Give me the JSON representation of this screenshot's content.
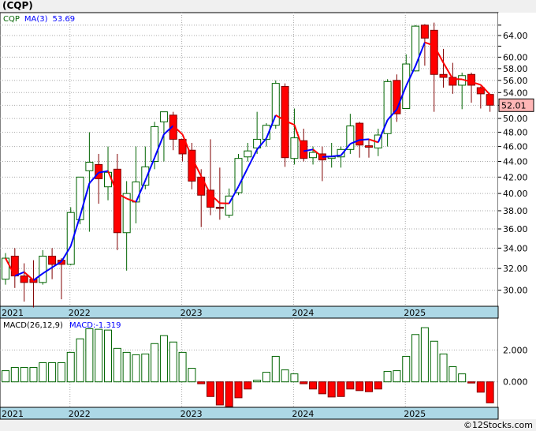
{
  "header": {
    "title": "(CQP)"
  },
  "footer": {
    "copyright": "©12Stocks.com"
  },
  "colors": {
    "up": "#006400",
    "down": "#ff0000",
    "ma_up": "#0000ff",
    "ma_down": "#ff0000",
    "axis_strip": "#add8e6",
    "last_price_bg": "#ffb6b6"
  },
  "chart_data": [
    {
      "type": "candlestick",
      "legend": {
        "symbol": "CQP",
        "ma_label": "MA(3)",
        "ma_value": "53.69"
      },
      "last_price": "52.01",
      "y_scale": "log",
      "ylim": [
        28.6,
        68.5
      ],
      "y_ticks": [
        "30.00",
        "32.00",
        "34.00",
        "36.00",
        "38.00",
        "40.00",
        "42.00",
        "44.00",
        "46.00",
        "48.00",
        "50.00",
        "52.00",
        "54.00",
        "56.00",
        "58.00",
        "60.00",
        "64.00"
      ],
      "x_labels": [
        "2021",
        "2022",
        "2023",
        "2024",
        "2025"
      ],
      "grid": true,
      "frequency": "monthly",
      "ohlc": [
        [
          31,
          33.5,
          30.5,
          33
        ],
        [
          33.2,
          34,
          30.2,
          31.3
        ],
        [
          31.3,
          32.5,
          29,
          30.7
        ],
        [
          31,
          32.8,
          28.5,
          30.7
        ],
        [
          30.7,
          33.8,
          30.5,
          33.2
        ],
        [
          33.2,
          34,
          31,
          32.4
        ],
        [
          32.8,
          33,
          29.2,
          32.4
        ],
        [
          32.4,
          38.4,
          32.3,
          37.8
        ],
        [
          37,
          42,
          36.5,
          42
        ],
        [
          42.8,
          48,
          35.7,
          43.9
        ],
        [
          43.6,
          45,
          38.8,
          41.8
        ],
        [
          40.8,
          46,
          39.2,
          42.6
        ],
        [
          43,
          45,
          33.8,
          35.6
        ],
        [
          35.6,
          41.5,
          31.8,
          40
        ],
        [
          39,
          46,
          36.6,
          41.4
        ],
        [
          41,
          46,
          40.5,
          43.3
        ],
        [
          44,
          49.5,
          43,
          48.8
        ],
        [
          49.5,
          51,
          44,
          51
        ],
        [
          50.5,
          51,
          45.5,
          47
        ],
        [
          47,
          47,
          44,
          45
        ],
        [
          45.5,
          46.5,
          40.5,
          41.5
        ],
        [
          42,
          43,
          36.2,
          39.8
        ],
        [
          40.4,
          47,
          37.5,
          38.4
        ],
        [
          38.4,
          43.2,
          37,
          38.4
        ],
        [
          37.5,
          40.6,
          37.2,
          39.7
        ],
        [
          40.1,
          45,
          39.8,
          44.4
        ],
        [
          44.6,
          46.5,
          44,
          45.4
        ],
        [
          45.8,
          51,
          45,
          47
        ],
        [
          47,
          49.3,
          46,
          49
        ],
        [
          49,
          56,
          48.5,
          55.5
        ],
        [
          55,
          55.5,
          43.3,
          44.5
        ],
        [
          44.4,
          51.5,
          43.6,
          47.2
        ],
        [
          46.8,
          48.5,
          44,
          44.4
        ],
        [
          44.5,
          46,
          43.6,
          45.2
        ],
        [
          45,
          46,
          41.5,
          44.2
        ],
        [
          44.4,
          46.5,
          43.2,
          44.6
        ],
        [
          44.6,
          46,
          43.2,
          45.6
        ],
        [
          45.6,
          50.7,
          45,
          48.9
        ],
        [
          49.3,
          49.5,
          44.5,
          46.2
        ],
        [
          46.1,
          47,
          44.5,
          45.9
        ],
        [
          45.8,
          48.5,
          44.7,
          47.6
        ],
        [
          47.8,
          56.2,
          46,
          55.8
        ],
        [
          56,
          57,
          49.5,
          50.7
        ],
        [
          51.5,
          60.5,
          51.5,
          58.8
        ],
        [
          57.6,
          66,
          57.5,
          65.8
        ],
        [
          66,
          66.2,
          58.5,
          63.5
        ],
        [
          65,
          66.5,
          51,
          57
        ],
        [
          57,
          61.5,
          54.8,
          56.5
        ],
        [
          56.5,
          59,
          53.8,
          55.2
        ],
        [
          55.2,
          57.3,
          51.4,
          56.8
        ],
        [
          57,
          57.3,
          52.4,
          55.2
        ],
        [
          54.8,
          55,
          51.5,
          53.8
        ],
        [
          53.7,
          53.8,
          51,
          52.01
        ]
      ]
    },
    {
      "type": "bar",
      "legend": {
        "label": "MACD(26,12,9)",
        "value_label": "MACD:-1.319"
      },
      "ylim": [
        -1.6,
        4.0
      ],
      "y_ticks": [
        "2.000",
        "0.000"
      ],
      "x_labels": [
        "2021",
        "2022",
        "2023",
        "2024",
        "2025"
      ],
      "values": [
        0.7,
        0.9,
        0.9,
        0.9,
        1.2,
        1.2,
        1.2,
        1.85,
        2.7,
        3.33,
        3.3,
        3.25,
        2.1,
        1.85,
        1.7,
        1.75,
        2.4,
        2.9,
        2.5,
        1.85,
        0.85,
        -0.12,
        -0.92,
        -1.45,
        -1.55,
        -1.0,
        -0.45,
        0.1,
        0.6,
        1.6,
        0.75,
        0.5,
        -0.12,
        -0.45,
        -0.75,
        -0.95,
        -0.92,
        -0.45,
        -0.55,
        -0.62,
        -0.45,
        0.65,
        0.7,
        1.6,
        2.97,
        3.4,
        2.55,
        1.75,
        0.95,
        0.5,
        -0.07,
        -0.65,
        -1.319
      ]
    }
  ]
}
